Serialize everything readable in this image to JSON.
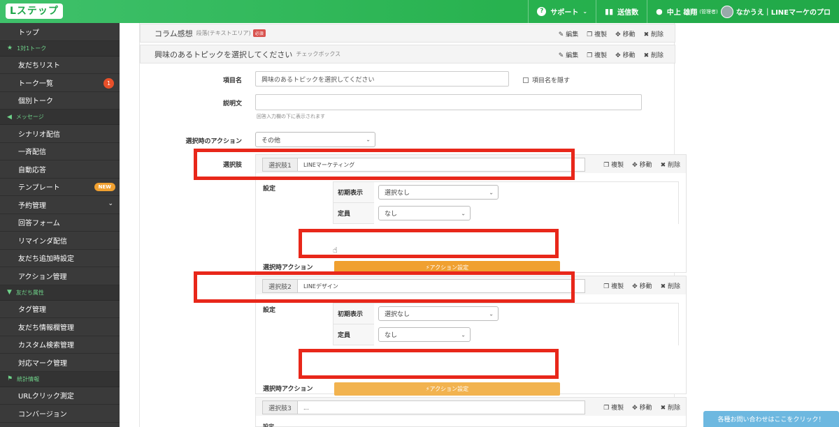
{
  "header": {
    "logo": "Lステップ",
    "support": "サポート",
    "sends": "送信数",
    "user": "中上 雄翔",
    "user_role": "(管理者)",
    "account": "なかうえ｜LINEマーケのプロ"
  },
  "sidebar": {
    "top": "トップ",
    "sec1": "1対1トーク",
    "friends": "友だちリスト",
    "talks": "トーク一覧",
    "talks_badge": "1",
    "individual": "個別トーク",
    "sec2": "メッセージ",
    "scenario": "シナリオ配信",
    "broadcast": "一斉配信",
    "auto_reply": "自動応答",
    "template": "テンプレート",
    "template_badge": "NEW",
    "reservation": "予約管理",
    "form": "回答フォーム",
    "reminder": "リマインダ配信",
    "add_friend": "友だち追加時設定",
    "action_mgmt": "アクション管理",
    "sec3": "友だち属性",
    "tag": "タグ管理",
    "info_field": "友だち情報欄管理",
    "custom_search": "カスタム検索管理",
    "mark": "対応マーク管理",
    "sec4": "統計情報",
    "url_click": "URLクリック測定",
    "conversion": "コンバージョン"
  },
  "actions": {
    "edit": "編集",
    "copy": "複製",
    "move": "移動",
    "delete": "削除"
  },
  "row1": {
    "title": "コラム感想",
    "sub": "段落(テキストエリア)",
    "required": "必須"
  },
  "row2": {
    "title": "興味のあるトピックを選択してください",
    "sub": "チェックボックス"
  },
  "form": {
    "item_name_label": "項目名",
    "item_name_value": "興味のあるトピックを選択してください",
    "hide_label": "項目名を隠す",
    "desc_label": "説明文",
    "desc_help": "回答入力欄の下に表示されます",
    "action_label": "選択時のアクション",
    "action_value": "その他",
    "choice_label": "選択肢"
  },
  "choices": [
    {
      "tag": "選択肢1",
      "value": "LINEマーケティング"
    },
    {
      "tag": "選択肢2",
      "value": "LINEデザイン"
    },
    {
      "tag": "選択肢3",
      "value": "..."
    }
  ],
  "choice_settings": {
    "settings_label": "設定",
    "initial_label": "初期表示",
    "initial_value": "選択なし",
    "capacity_label": "定員",
    "capacity_value": "なし",
    "action_label": "選択時アクション",
    "action_button": "アクション設定",
    "settings_label_cut": "設定"
  },
  "help_button": "各種お問い合わせはここをクリック！",
  "colors": {
    "header_green": "#28b24f",
    "sidebar_bg": "#3a3a3a",
    "action_orange": "#f0a030",
    "highlight_red": "#e8271a"
  }
}
